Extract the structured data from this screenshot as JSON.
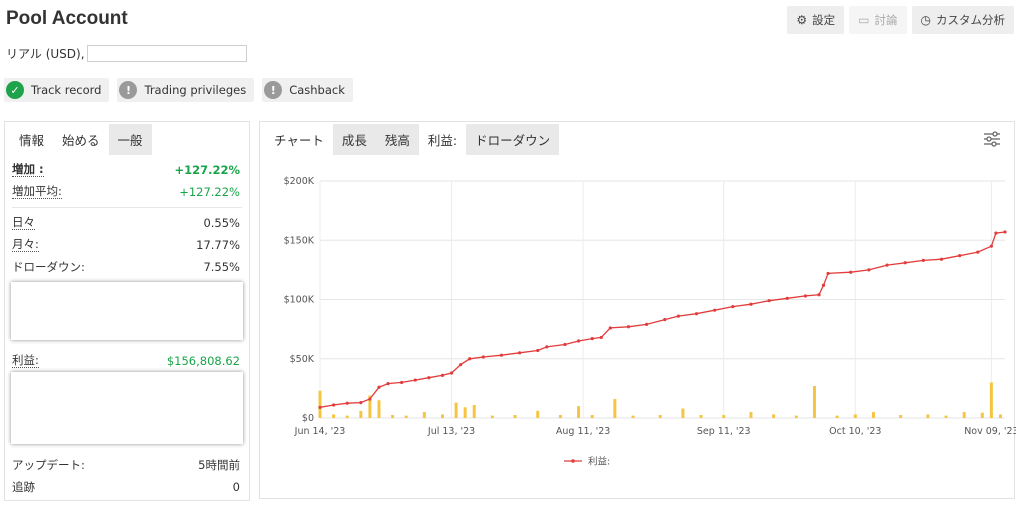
{
  "header": {
    "title": "Pool Account",
    "account_type": "リアル (USD),",
    "buttons": {
      "settings": "設定",
      "discussion": "討論",
      "custom_analysis": "カスタム分析"
    }
  },
  "badges": [
    {
      "label": "Track record",
      "status": "ok",
      "symbol": "✓"
    },
    {
      "label": "Trading privileges",
      "status": "warn",
      "symbol": "!"
    },
    {
      "label": "Cashback",
      "status": "warn",
      "symbol": "!"
    }
  ],
  "left_panel": {
    "tabs": [
      "情報",
      "始める",
      "一般"
    ],
    "active_tab_index": 2,
    "stats": {
      "gain": {
        "label": "増加 :",
        "value": "+127.22%"
      },
      "abs_gain": {
        "label": "増加平均:",
        "value": "+127.22%"
      },
      "daily": {
        "label": "日々",
        "value": "0.55%"
      },
      "monthly": {
        "label": "月々:",
        "value": "17.77%"
      },
      "drawdown": {
        "label": "ドローダウン:",
        "value": "7.55%"
      },
      "profit": {
        "label": "利益:",
        "value": "$156,808.62"
      },
      "updated": {
        "label": "アップデート:",
        "value": "5時間前"
      },
      "tracking": {
        "label": "追跡",
        "value": "0"
      }
    }
  },
  "chart_panel": {
    "tabs": [
      "チャート",
      "成長",
      "残高",
      "利益:",
      "ドローダウン"
    ],
    "active_tabs": [
      1,
      2,
      4
    ],
    "selected_tab_index": 3,
    "colors": {
      "line": "#e23c3c",
      "bars": "#f5c542"
    }
  },
  "chart_data": {
    "type": "line",
    "title": "",
    "y_ticks": [
      "$0",
      "$50K",
      "$100K",
      "$150K",
      "$200K"
    ],
    "ylim": [
      0,
      200000
    ],
    "x_ticks": [
      "Jun 14, '23",
      "Jul 13, '23",
      "Aug 11, '23",
      "Sep 11, '23",
      "Oct 10, '23",
      "Nov 09, '23"
    ],
    "xlim": [
      "2023-06-14",
      "2023-11-12"
    ],
    "legend": "利益:",
    "legend_position": "bottom-center",
    "grid": true,
    "series": [
      {
        "name": "利益:",
        "points": [
          [
            "2023-06-14",
            9000
          ],
          [
            "2023-06-17",
            11000
          ],
          [
            "2023-06-20",
            12500
          ],
          [
            "2023-06-23",
            13000
          ],
          [
            "2023-06-25",
            16000
          ],
          [
            "2023-06-27",
            26000
          ],
          [
            "2023-06-29",
            29000
          ],
          [
            "2023-07-02",
            30000
          ],
          [
            "2023-07-05",
            32000
          ],
          [
            "2023-07-08",
            34000
          ],
          [
            "2023-07-11",
            36000
          ],
          [
            "2023-07-13",
            38000
          ],
          [
            "2023-07-15",
            45000
          ],
          [
            "2023-07-17",
            50000
          ],
          [
            "2023-07-20",
            51500
          ],
          [
            "2023-07-24",
            53000
          ],
          [
            "2023-07-28",
            55000
          ],
          [
            "2023-08-01",
            57000
          ],
          [
            "2023-08-03",
            60000
          ],
          [
            "2023-08-07",
            62000
          ],
          [
            "2023-08-10",
            65000
          ],
          [
            "2023-08-13",
            67000
          ],
          [
            "2023-08-15",
            68000
          ],
          [
            "2023-08-17",
            76000
          ],
          [
            "2023-08-21",
            77000
          ],
          [
            "2023-08-25",
            79000
          ],
          [
            "2023-08-29",
            83000
          ],
          [
            "2023-09-01",
            86000
          ],
          [
            "2023-09-05",
            88000
          ],
          [
            "2023-09-09",
            91000
          ],
          [
            "2023-09-13",
            94000
          ],
          [
            "2023-09-17",
            96000
          ],
          [
            "2023-09-21",
            99000
          ],
          [
            "2023-09-25",
            101000
          ],
          [
            "2023-09-29",
            103000
          ],
          [
            "2023-10-02",
            104000
          ],
          [
            "2023-10-03",
            112000
          ],
          [
            "2023-10-04",
            122000
          ],
          [
            "2023-10-09",
            123000
          ],
          [
            "2023-10-13",
            125000
          ],
          [
            "2023-10-17",
            129000
          ],
          [
            "2023-10-21",
            131000
          ],
          [
            "2023-10-25",
            133000
          ],
          [
            "2023-10-29",
            134000
          ],
          [
            "2023-11-02",
            137000
          ],
          [
            "2023-11-06",
            140000
          ],
          [
            "2023-11-09",
            145000
          ],
          [
            "2023-11-10",
            156000
          ],
          [
            "2023-11-12",
            157000
          ]
        ]
      },
      {
        "name": "",
        "type": "bar",
        "points": [
          [
            "2023-06-14",
            23000
          ],
          [
            "2023-06-17",
            3000
          ],
          [
            "2023-06-20",
            2000
          ],
          [
            "2023-06-23",
            6000
          ],
          [
            "2023-06-25",
            19000
          ],
          [
            "2023-06-27",
            15000
          ],
          [
            "2023-06-30",
            2500
          ],
          [
            "2023-07-03",
            2000
          ],
          [
            "2023-07-07",
            5000
          ],
          [
            "2023-07-11",
            3000
          ],
          [
            "2023-07-14",
            13000
          ],
          [
            "2023-07-16",
            9000
          ],
          [
            "2023-07-18",
            11000
          ],
          [
            "2023-07-22",
            2000
          ],
          [
            "2023-07-27",
            2500
          ],
          [
            "2023-08-01",
            6000
          ],
          [
            "2023-08-06",
            2500
          ],
          [
            "2023-08-10",
            10000
          ],
          [
            "2023-08-13",
            2500
          ],
          [
            "2023-08-18",
            16000
          ],
          [
            "2023-08-22",
            2000
          ],
          [
            "2023-08-28",
            2500
          ],
          [
            "2023-09-02",
            8000
          ],
          [
            "2023-09-06",
            2500
          ],
          [
            "2023-09-11",
            2500
          ],
          [
            "2023-09-17",
            5000
          ],
          [
            "2023-09-22",
            3000
          ],
          [
            "2023-09-27",
            2000
          ],
          [
            "2023-10-01",
            27000
          ],
          [
            "2023-10-06",
            2000
          ],
          [
            "2023-10-10",
            3000
          ],
          [
            "2023-10-14",
            5000
          ],
          [
            "2023-10-20",
            2500
          ],
          [
            "2023-10-26",
            3000
          ],
          [
            "2023-10-30",
            2000
          ],
          [
            "2023-11-03",
            5000
          ],
          [
            "2023-11-07",
            4500
          ],
          [
            "2023-11-09",
            30000
          ],
          [
            "2023-11-11",
            3000
          ]
        ]
      }
    ]
  }
}
